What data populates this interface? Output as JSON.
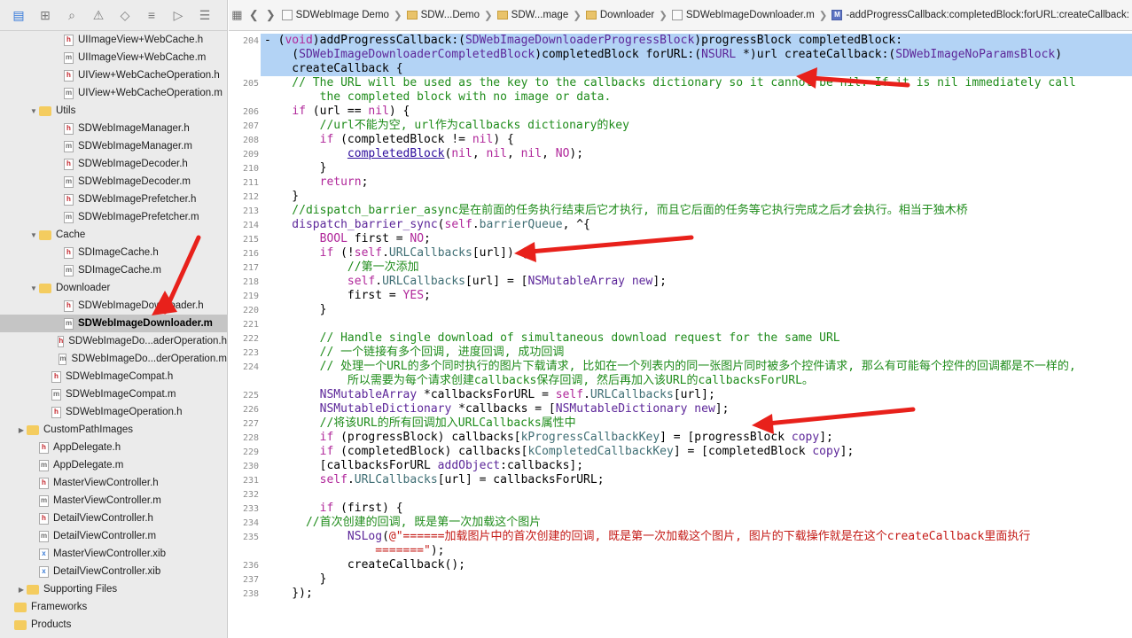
{
  "navigator": {
    "toolbar": [
      "folder-icon",
      "hierarchy-icon",
      "search-icon",
      "warning-icon",
      "test-icon",
      "debug-icon",
      "breakpoint-icon",
      "report-icon"
    ],
    "items": [
      {
        "label": "UIImageView+WebCache.h",
        "type": "h",
        "indent": 3
      },
      {
        "label": "UIImageView+WebCache.m",
        "type": "m",
        "indent": 3
      },
      {
        "label": "UIView+WebCacheOperation.h",
        "type": "h",
        "indent": 3
      },
      {
        "label": "UIView+WebCacheOperation.m",
        "type": "m",
        "indent": 3
      },
      {
        "label": "Utils",
        "type": "folder",
        "indent": 1,
        "open": true
      },
      {
        "label": "SDWebImageManager.h",
        "type": "h",
        "indent": 3
      },
      {
        "label": "SDWebImageManager.m",
        "type": "m",
        "indent": 3
      },
      {
        "label": "SDWebImageDecoder.h",
        "type": "h",
        "indent": 3
      },
      {
        "label": "SDWebImageDecoder.m",
        "type": "m",
        "indent": 3
      },
      {
        "label": "SDWebImagePrefetcher.h",
        "type": "h",
        "indent": 3
      },
      {
        "label": "SDWebImagePrefetcher.m",
        "type": "m",
        "indent": 3
      },
      {
        "label": "Cache",
        "type": "folder",
        "indent": 1,
        "open": true
      },
      {
        "label": "SDImageCache.h",
        "type": "h",
        "indent": 3
      },
      {
        "label": "SDImageCache.m",
        "type": "m",
        "indent": 3
      },
      {
        "label": "Downloader",
        "type": "folder",
        "indent": 1,
        "open": true
      },
      {
        "label": "SDWebImageDownloader.h",
        "type": "h",
        "indent": 3
      },
      {
        "label": "SDWebImageDownloader.m",
        "type": "m",
        "indent": 3,
        "selected": true
      },
      {
        "label": "SDWebImageDo...aderOperation.h",
        "type": "h",
        "indent": 3
      },
      {
        "label": "SDWebImageDo...derOperation.m",
        "type": "m",
        "indent": 3
      },
      {
        "label": "SDWebImageCompat.h",
        "type": "h",
        "indent": 2
      },
      {
        "label": "SDWebImageCompat.m",
        "type": "m",
        "indent": 2
      },
      {
        "label": "SDWebImageOperation.h",
        "type": "h",
        "indent": 2
      },
      {
        "label": "CustomPathImages",
        "type": "folder",
        "indent": 0,
        "open": false
      },
      {
        "label": "AppDelegate.h",
        "type": "h",
        "indent": 1
      },
      {
        "label": "AppDelegate.m",
        "type": "m",
        "indent": 1
      },
      {
        "label": "MasterViewController.h",
        "type": "h",
        "indent": 1
      },
      {
        "label": "MasterViewController.m",
        "type": "m",
        "indent": 1
      },
      {
        "label": "DetailViewController.h",
        "type": "h",
        "indent": 1
      },
      {
        "label": "DetailViewController.m",
        "type": "m",
        "indent": 1
      },
      {
        "label": "MasterViewController.xib",
        "type": "xib",
        "indent": 1
      },
      {
        "label": "DetailViewController.xib",
        "type": "xib",
        "indent": 1
      },
      {
        "label": "Supporting Files",
        "type": "folder",
        "indent": 0,
        "open": false
      },
      {
        "label": "Frameworks",
        "type": "folder",
        "indent": -1,
        "open": null
      },
      {
        "label": "Products",
        "type": "folder",
        "indent": -1,
        "open": null
      }
    ]
  },
  "jumpbar": {
    "crumbs": [
      {
        "label": "SDWebImage Demo",
        "icon": "project"
      },
      {
        "label": "SDW...Demo",
        "icon": "folder"
      },
      {
        "label": "SDW...mage",
        "icon": "folder"
      },
      {
        "label": "Downloader",
        "icon": "folder"
      },
      {
        "label": "SDWebImageDownloader.m",
        "icon": "file"
      },
      {
        "label": "-addProgressCallback:completedBlock:forURL:createCallback:",
        "icon": "method"
      }
    ]
  },
  "editor": {
    "lines": [
      {
        "n": "204",
        "hl": true,
        "segs": [
          [
            "pl",
            "- ("
          ],
          [
            "kw",
            "void"
          ],
          [
            "pl",
            ")addProgressCallback:("
          ],
          [
            "cls",
            "SDWebImageDownloaderProgressBlock"
          ],
          [
            "pl",
            ")progressBlock completedBlock:"
          ]
        ]
      },
      {
        "n": "",
        "hl": true,
        "segs": [
          [
            "pl",
            "    ("
          ],
          [
            "cls",
            "SDWebImageDownloaderCompletedBlock"
          ],
          [
            "pl",
            ")completedBlock forURL:("
          ],
          [
            "cls",
            "NSURL"
          ],
          [
            "pl",
            " *)url createCallback:("
          ],
          [
            "cls",
            "SDWebImageNoParamsBlock"
          ],
          [
            "pl",
            ")"
          ]
        ]
      },
      {
        "n": "",
        "hl": true,
        "segs": [
          [
            "pl",
            "    createCallback {"
          ]
        ]
      },
      {
        "n": "205",
        "segs": [
          [
            "cm",
            "    // The URL will be used as the key to the callbacks dictionary so it cannot be nil. If it is nil immediately call"
          ]
        ]
      },
      {
        "n": "",
        "segs": [
          [
            "cm",
            "        the completed block with no image or data."
          ]
        ]
      },
      {
        "n": "206",
        "segs": [
          [
            "pl",
            "    "
          ],
          [
            "kw",
            "if"
          ],
          [
            "pl",
            " (url == "
          ],
          [
            "kw",
            "nil"
          ],
          [
            "pl",
            ") {"
          ]
        ]
      },
      {
        "n": "207",
        "segs": [
          [
            "cm",
            "        //url不能为空, url作为callbacks dictionary的key"
          ]
        ]
      },
      {
        "n": "208",
        "segs": [
          [
            "pl",
            "        "
          ],
          [
            "kw",
            "if"
          ],
          [
            "pl",
            " (completedBlock != "
          ],
          [
            "kw",
            "nil"
          ],
          [
            "pl",
            ") {"
          ]
        ]
      },
      {
        "n": "209",
        "segs": [
          [
            "pl",
            "            "
          ],
          [
            "fn",
            "completedBlock"
          ],
          [
            "pl",
            "("
          ],
          [
            "kw",
            "nil"
          ],
          [
            "pl",
            ", "
          ],
          [
            "kw",
            "nil"
          ],
          [
            "pl",
            ", "
          ],
          [
            "kw",
            "nil"
          ],
          [
            "pl",
            ", "
          ],
          [
            "kw",
            "NO"
          ],
          [
            "pl",
            ");"
          ]
        ]
      },
      {
        "n": "210",
        "segs": [
          [
            "pl",
            "        }"
          ]
        ]
      },
      {
        "n": "211",
        "segs": [
          [
            "pl",
            "        "
          ],
          [
            "kw",
            "return"
          ],
          [
            "pl",
            ";"
          ]
        ]
      },
      {
        "n": "212",
        "segs": [
          [
            "pl",
            "    }"
          ]
        ]
      },
      {
        "n": "213",
        "segs": [
          [
            "cm",
            "    //dispatch_barrier_async是在前面的任务执行结束后它才执行, 而且它后面的任务等它执行完成之后才会执行。相当于独木桥"
          ]
        ]
      },
      {
        "n": "214",
        "segs": [
          [
            "cls",
            "    dispatch_barrier_sync"
          ],
          [
            "pl",
            "("
          ],
          [
            "kw",
            "self"
          ],
          [
            "pl",
            "."
          ],
          [
            "prop",
            "barrierQueue"
          ],
          [
            "pl",
            ", ^{"
          ]
        ]
      },
      {
        "n": "215",
        "segs": [
          [
            "pl",
            "        "
          ],
          [
            "kw",
            "BOOL"
          ],
          [
            "pl",
            " first = "
          ],
          [
            "kw",
            "NO"
          ],
          [
            "pl",
            ";"
          ]
        ]
      },
      {
        "n": "216",
        "segs": [
          [
            "pl",
            "        "
          ],
          [
            "kw",
            "if"
          ],
          [
            "pl",
            " (!"
          ],
          [
            "kw",
            "self"
          ],
          [
            "pl",
            "."
          ],
          [
            "prop",
            "URLCallbacks"
          ],
          [
            "pl",
            "[url]) {"
          ]
        ]
      },
      {
        "n": "217",
        "segs": [
          [
            "cm",
            "            //第一次添加"
          ]
        ]
      },
      {
        "n": "218",
        "segs": [
          [
            "pl",
            "            "
          ],
          [
            "kw",
            "self"
          ],
          [
            "pl",
            "."
          ],
          [
            "prop",
            "URLCallbacks"
          ],
          [
            "pl",
            "[url] = ["
          ],
          [
            "cls",
            "NSMutableArray"
          ],
          [
            "pl",
            " "
          ],
          [
            "cls",
            "new"
          ],
          [
            "pl",
            "];"
          ]
        ]
      },
      {
        "n": "219",
        "segs": [
          [
            "pl",
            "            first = "
          ],
          [
            "kw",
            "YES"
          ],
          [
            "pl",
            ";"
          ]
        ]
      },
      {
        "n": "220",
        "segs": [
          [
            "pl",
            "        }"
          ]
        ]
      },
      {
        "n": "221",
        "segs": [
          [
            "pl",
            ""
          ]
        ]
      },
      {
        "n": "222",
        "segs": [
          [
            "cm",
            "        // Handle single download of simultaneous download request for the same URL"
          ]
        ]
      },
      {
        "n": "223",
        "segs": [
          [
            "cm",
            "        // 一个链接有多个回调, 进度回调, 成功回调"
          ]
        ]
      },
      {
        "n": "224",
        "segs": [
          [
            "cm",
            "        // 处理一个URL的多个同时执行的图片下载请求, 比如在一个列表内的同一张图片同时被多个控件请求, 那么有可能每个控件的回调都是不一样的,"
          ]
        ]
      },
      {
        "n": "",
        "segs": [
          [
            "cm",
            "            所以需要为每个请求创建callbacks保存回调, 然后再加入该URL的callbacksForURL。"
          ]
        ]
      },
      {
        "n": "225",
        "segs": [
          [
            "pl",
            "        "
          ],
          [
            "cls",
            "NSMutableArray"
          ],
          [
            "pl",
            " *callbacksForURL = "
          ],
          [
            "kw",
            "self"
          ],
          [
            "pl",
            "."
          ],
          [
            "prop",
            "URLCallbacks"
          ],
          [
            "pl",
            "[url];"
          ]
        ]
      },
      {
        "n": "226",
        "segs": [
          [
            "pl",
            "        "
          ],
          [
            "cls",
            "NSMutableDictionary"
          ],
          [
            "pl",
            " *callbacks = ["
          ],
          [
            "cls",
            "NSMutableDictionary"
          ],
          [
            "pl",
            " "
          ],
          [
            "cls",
            "new"
          ],
          [
            "pl",
            "];"
          ]
        ]
      },
      {
        "n": "227",
        "segs": [
          [
            "cm",
            "        //将该URL的所有回调加入URLCallbacks属性中"
          ]
        ]
      },
      {
        "n": "228",
        "segs": [
          [
            "pl",
            "        "
          ],
          [
            "kw",
            "if"
          ],
          [
            "pl",
            " (progressBlock) callbacks["
          ],
          [
            "prop",
            "kProgressCallbackKey"
          ],
          [
            "pl",
            "] = [progressBlock "
          ],
          [
            "cls",
            "copy"
          ],
          [
            "pl",
            "];"
          ]
        ]
      },
      {
        "n": "229",
        "segs": [
          [
            "pl",
            "        "
          ],
          [
            "kw",
            "if"
          ],
          [
            "pl",
            " (completedBlock) callbacks["
          ],
          [
            "prop",
            "kCompletedCallbackKey"
          ],
          [
            "pl",
            "] = [completedBlock "
          ],
          [
            "cls",
            "copy"
          ],
          [
            "pl",
            "];"
          ]
        ]
      },
      {
        "n": "230",
        "segs": [
          [
            "pl",
            "        [callbacksForURL "
          ],
          [
            "cls",
            "addObject"
          ],
          [
            "pl",
            ":callbacks];"
          ]
        ]
      },
      {
        "n": "231",
        "segs": [
          [
            "pl",
            "        "
          ],
          [
            "kw",
            "self"
          ],
          [
            "pl",
            "."
          ],
          [
            "prop",
            "URLCallbacks"
          ],
          [
            "pl",
            "[url] = callbacksForURL;"
          ]
        ]
      },
      {
        "n": "232",
        "segs": [
          [
            "pl",
            ""
          ]
        ]
      },
      {
        "n": "233",
        "segs": [
          [
            "pl",
            "        "
          ],
          [
            "kw",
            "if"
          ],
          [
            "pl",
            " (first) {"
          ]
        ]
      },
      {
        "n": "234",
        "segs": [
          [
            "cm",
            "      //首次创建的回调, 既是第一次加载这个图片"
          ]
        ]
      },
      {
        "n": "235",
        "segs": [
          [
            "pl",
            "            "
          ],
          [
            "cls",
            "NSLog"
          ],
          [
            "pl",
            "("
          ],
          [
            "str",
            "@\"======加载图片中的首次创建的回调, 既是第一次加载这个图片, 图片的下载操作就是在这个createCallback里面执行"
          ]
        ]
      },
      {
        "n": "",
        "segs": [
          [
            "str",
            "                =======\""
          ],
          [
            "pl",
            ");"
          ]
        ]
      },
      {
        "n": "236",
        "segs": [
          [
            "pl",
            "            createCallback();"
          ]
        ]
      },
      {
        "n": "237",
        "segs": [
          [
            "pl",
            "        }"
          ]
        ]
      },
      {
        "n": "238",
        "segs": [
          [
            "pl",
            "    });"
          ]
        ]
      }
    ]
  },
  "colors": {
    "annotation_arrow": "#e8211b",
    "selection": "#b3d3f5",
    "keyword": "#b0279a",
    "comment": "#1f8c1b",
    "string": "#c41a16"
  }
}
